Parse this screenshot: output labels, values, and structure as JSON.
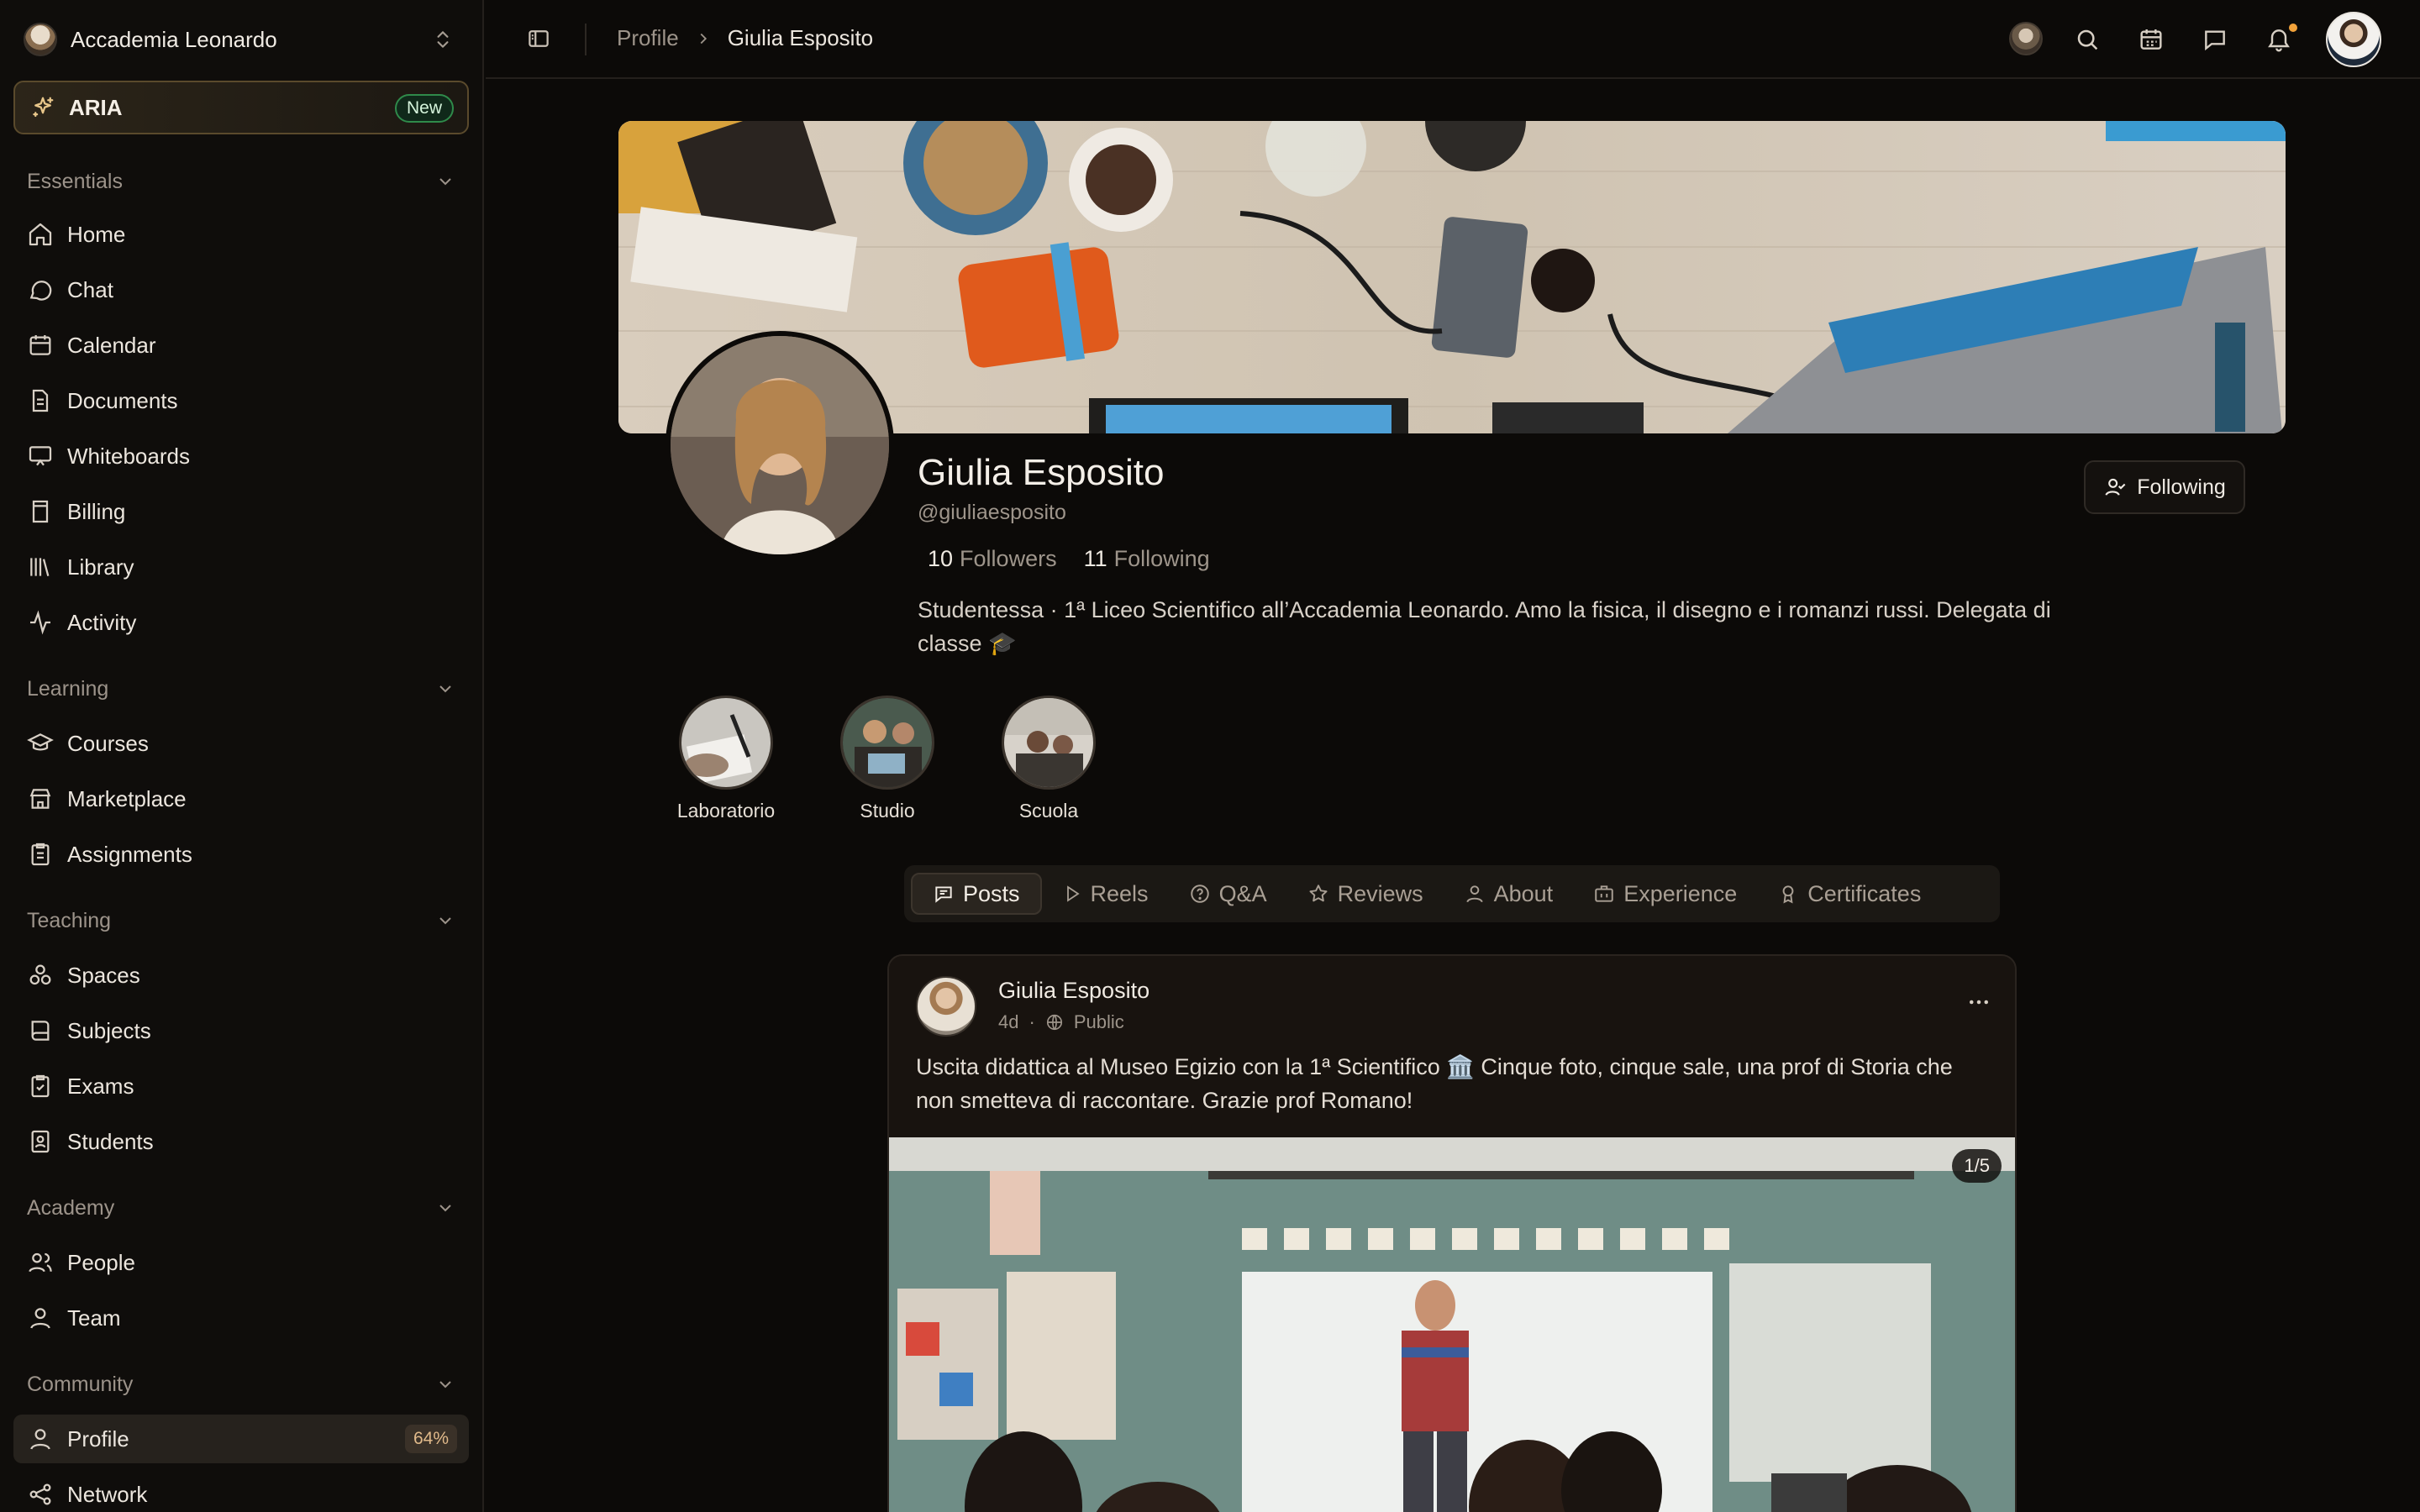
{
  "org": {
    "name": "Accademia Leonardo"
  },
  "aria": {
    "label": "ARIA",
    "badge": "New"
  },
  "sidebar": {
    "sections": [
      {
        "title": "Essentials",
        "items": [
          {
            "label": "Home",
            "icon": "home-icon"
          },
          {
            "label": "Chat",
            "icon": "chat-icon"
          },
          {
            "label": "Calendar",
            "icon": "calendar-icon"
          },
          {
            "label": "Documents",
            "icon": "document-icon"
          },
          {
            "label": "Whiteboards",
            "icon": "whiteboard-icon"
          },
          {
            "label": "Billing",
            "icon": "billing-icon"
          },
          {
            "label": "Library",
            "icon": "library-icon"
          },
          {
            "label": "Activity",
            "icon": "activity-icon"
          }
        ]
      },
      {
        "title": "Learning",
        "items": [
          {
            "label": "Courses",
            "icon": "graduation-cap-icon"
          },
          {
            "label": "Marketplace",
            "icon": "store-icon"
          },
          {
            "label": "Assignments",
            "icon": "clipboard-icon"
          }
        ]
      },
      {
        "title": "Teaching",
        "items": [
          {
            "label": "Spaces",
            "icon": "spaces-icon"
          },
          {
            "label": "Subjects",
            "icon": "book-icon"
          },
          {
            "label": "Exams",
            "icon": "clipboard-check-icon"
          },
          {
            "label": "Students",
            "icon": "id-badge-icon"
          }
        ]
      },
      {
        "title": "Academy",
        "items": [
          {
            "label": "People",
            "icon": "people-icon"
          },
          {
            "label": "Team",
            "icon": "user-icon"
          }
        ]
      },
      {
        "title": "Community",
        "items": [
          {
            "label": "Profile",
            "icon": "user-icon",
            "active": true,
            "badge": "64%"
          },
          {
            "label": "Network",
            "icon": "share-icon"
          }
        ]
      }
    ]
  },
  "topbar": {
    "breadcrumb": [
      "Profile",
      "Giulia Esposito"
    ]
  },
  "profile": {
    "name": "Giulia Esposito",
    "handle": "@giuliaesposito",
    "followers_count": "10",
    "followers_label": "Followers",
    "following_count": "11",
    "following_label": "Following",
    "bio": "Studentessa · 1ª Liceo Scientifico all’Accademia Leonardo. Amo la fisica, il disegno e i romanzi russi. Delegata di classe 🎓",
    "follow_button": "Following",
    "highlights": [
      "Laboratorio",
      "Studio",
      "Scuola"
    ]
  },
  "tabs": [
    {
      "label": "Posts",
      "icon": "chat-square-icon",
      "active": true
    },
    {
      "label": "Reels",
      "icon": "play-icon"
    },
    {
      "label": "Q&A",
      "icon": "question-icon"
    },
    {
      "label": "Reviews",
      "icon": "star-icon"
    },
    {
      "label": "About",
      "icon": "user-icon"
    },
    {
      "label": "Experience",
      "icon": "building-icon"
    },
    {
      "label": "Certificates",
      "icon": "award-icon"
    }
  ],
  "post": {
    "author": "Giulia Esposito",
    "age": "4d",
    "visibility": "Public",
    "text": "Uscita didattica al Museo Egizio con la 1ª Scientifico 🏛️ Cinque foto, cinque sale, una prof di Storia che non smetteva di raccontare. Grazie prof Romano!",
    "image_counter": "1/5"
  }
}
